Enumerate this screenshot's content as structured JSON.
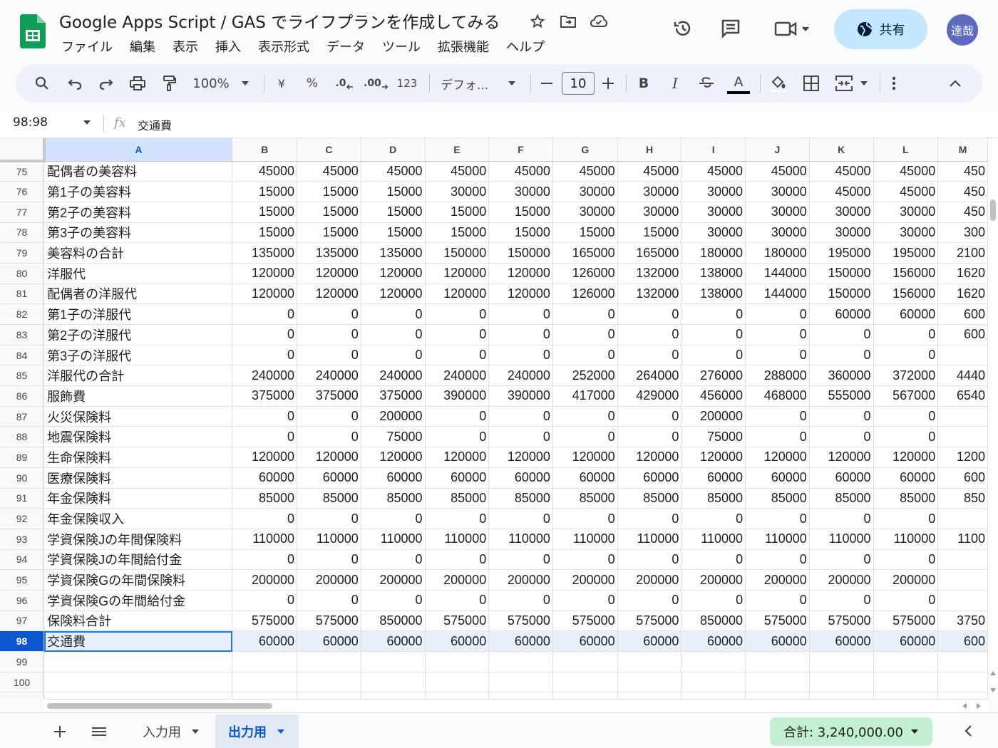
{
  "doc": {
    "title": "Google Apps Script / GAS でライフプランを作成してみる",
    "menu": [
      "ファイル",
      "編集",
      "表示",
      "挿入",
      "表示形式",
      "データ",
      "ツール",
      "拡張機能",
      "ヘルプ"
    ],
    "share_label": "共有",
    "avatar_initials": "達哉"
  },
  "toolbar": {
    "zoom": "100%",
    "currency": "¥",
    "percent": "%",
    "format_123": "123",
    "font": "デフォ...",
    "font_size": "10",
    "decrease_decimal": ".0",
    "increase_decimal": ".00",
    "bold": "B",
    "italic": "I",
    "text_color_glyph": "A"
  },
  "formula_bar": {
    "name_box": "98:98",
    "fx": "fx",
    "formula": "交通費"
  },
  "grid": {
    "columns": [
      "A",
      "B",
      "C",
      "D",
      "E",
      "F",
      "G",
      "H",
      "I",
      "J",
      "K",
      "L",
      "M"
    ],
    "rows": [
      {
        "num": "75",
        "label": "配偶者の美容料",
        "values": [
          "45000",
          "45000",
          "45000",
          "45000",
          "45000",
          "45000",
          "45000",
          "45000",
          "45000",
          "45000",
          "45000",
          "450"
        ]
      },
      {
        "num": "76",
        "label": "第1子の美容料",
        "values": [
          "15000",
          "15000",
          "15000",
          "30000",
          "30000",
          "30000",
          "30000",
          "30000",
          "30000",
          "45000",
          "45000",
          "450"
        ]
      },
      {
        "num": "77",
        "label": "第2子の美容料",
        "values": [
          "15000",
          "15000",
          "15000",
          "15000",
          "15000",
          "30000",
          "30000",
          "30000",
          "30000",
          "30000",
          "30000",
          "450"
        ]
      },
      {
        "num": "78",
        "label": "第3子の美容料",
        "values": [
          "15000",
          "15000",
          "15000",
          "15000",
          "15000",
          "15000",
          "15000",
          "30000",
          "30000",
          "30000",
          "30000",
          "300"
        ]
      },
      {
        "num": "79",
        "label": "美容料の合計",
        "values": [
          "135000",
          "135000",
          "135000",
          "150000",
          "150000",
          "165000",
          "165000",
          "180000",
          "180000",
          "195000",
          "195000",
          "2100"
        ]
      },
      {
        "num": "80",
        "label": "洋服代",
        "values": [
          "120000",
          "120000",
          "120000",
          "120000",
          "120000",
          "126000",
          "132000",
          "138000",
          "144000",
          "150000",
          "156000",
          "1620"
        ]
      },
      {
        "num": "81",
        "label": "配偶者の洋服代",
        "values": [
          "120000",
          "120000",
          "120000",
          "120000",
          "120000",
          "126000",
          "132000",
          "138000",
          "144000",
          "150000",
          "156000",
          "1620"
        ]
      },
      {
        "num": "82",
        "label": "第1子の洋服代",
        "values": [
          "0",
          "0",
          "0",
          "0",
          "0",
          "0",
          "0",
          "0",
          "0",
          "60000",
          "60000",
          "600"
        ]
      },
      {
        "num": "83",
        "label": "第2子の洋服代",
        "values": [
          "0",
          "0",
          "0",
          "0",
          "0",
          "0",
          "0",
          "0",
          "0",
          "0",
          "0",
          "600"
        ]
      },
      {
        "num": "84",
        "label": "第3子の洋服代",
        "values": [
          "0",
          "0",
          "0",
          "0",
          "0",
          "0",
          "0",
          "0",
          "0",
          "0",
          "0",
          ""
        ]
      },
      {
        "num": "85",
        "label": "洋服代の合計",
        "values": [
          "240000",
          "240000",
          "240000",
          "240000",
          "240000",
          "252000",
          "264000",
          "276000",
          "288000",
          "360000",
          "372000",
          "4440"
        ]
      },
      {
        "num": "86",
        "label": "服飾費",
        "values": [
          "375000",
          "375000",
          "375000",
          "390000",
          "390000",
          "417000",
          "429000",
          "456000",
          "468000",
          "555000",
          "567000",
          "6540"
        ]
      },
      {
        "num": "87",
        "label": "火災保険料",
        "values": [
          "0",
          "0",
          "200000",
          "0",
          "0",
          "0",
          "0",
          "200000",
          "0",
          "0",
          "0",
          ""
        ]
      },
      {
        "num": "88",
        "label": "地震保険料",
        "values": [
          "0",
          "0",
          "75000",
          "0",
          "0",
          "0",
          "0",
          "75000",
          "0",
          "0",
          "0",
          ""
        ]
      },
      {
        "num": "89",
        "label": "生命保険料",
        "values": [
          "120000",
          "120000",
          "120000",
          "120000",
          "120000",
          "120000",
          "120000",
          "120000",
          "120000",
          "120000",
          "120000",
          "1200"
        ]
      },
      {
        "num": "90",
        "label": "医療保険料",
        "values": [
          "60000",
          "60000",
          "60000",
          "60000",
          "60000",
          "60000",
          "60000",
          "60000",
          "60000",
          "60000",
          "60000",
          "600"
        ]
      },
      {
        "num": "91",
        "label": "年金保険料",
        "values": [
          "85000",
          "85000",
          "85000",
          "85000",
          "85000",
          "85000",
          "85000",
          "85000",
          "85000",
          "85000",
          "85000",
          "850"
        ]
      },
      {
        "num": "92",
        "label": "年金保険収入",
        "values": [
          "0",
          "0",
          "0",
          "0",
          "0",
          "0",
          "0",
          "0",
          "0",
          "0",
          "0",
          ""
        ]
      },
      {
        "num": "93",
        "label": "学資保険Jの年間保険料",
        "values": [
          "110000",
          "110000",
          "110000",
          "110000",
          "110000",
          "110000",
          "110000",
          "110000",
          "110000",
          "110000",
          "110000",
          "1100"
        ]
      },
      {
        "num": "94",
        "label": "学資保険Jの年間給付金",
        "values": [
          "0",
          "0",
          "0",
          "0",
          "0",
          "0",
          "0",
          "0",
          "0",
          "0",
          "0",
          ""
        ]
      },
      {
        "num": "95",
        "label": "学資保険Gの年間保険料",
        "values": [
          "200000",
          "200000",
          "200000",
          "200000",
          "200000",
          "200000",
          "200000",
          "200000",
          "200000",
          "200000",
          "200000",
          ""
        ]
      },
      {
        "num": "96",
        "label": "学資保険Gの年間給付金",
        "values": [
          "0",
          "0",
          "0",
          "0",
          "0",
          "0",
          "0",
          "0",
          "0",
          "0",
          "0",
          ""
        ]
      },
      {
        "num": "97",
        "label": "保険料合計",
        "values": [
          "575000",
          "575000",
          "850000",
          "575000",
          "575000",
          "575000",
          "575000",
          "850000",
          "575000",
          "575000",
          "575000",
          "3750"
        ]
      },
      {
        "num": "98",
        "label": "交通費",
        "values": [
          "60000",
          "60000",
          "60000",
          "60000",
          "60000",
          "60000",
          "60000",
          "60000",
          "60000",
          "60000",
          "60000",
          "600"
        ],
        "selected": true
      },
      {
        "num": "99",
        "label": "",
        "values": [
          "",
          "",
          "",
          "",
          "",
          "",
          "",
          "",
          "",
          "",
          "",
          ""
        ]
      },
      {
        "num": "100",
        "label": "",
        "values": [
          "",
          "",
          "",
          "",
          "",
          "",
          "",
          "",
          "",
          "",
          "",
          ""
        ]
      },
      {
        "num": "101",
        "label": "",
        "values": [
          "",
          "",
          "",
          "",
          "",
          "",
          "",
          "",
          "",
          "",
          "",
          ""
        ]
      }
    ]
  },
  "sheets": {
    "tabs": [
      {
        "label": "入力用",
        "active": false
      },
      {
        "label": "出力用",
        "active": true
      }
    ],
    "sum_label": "合計: 3,240,000.00"
  },
  "colors": {
    "accent": "#0b57d0",
    "share_bg": "#c2e7ff",
    "sum_bg": "#c4eed0",
    "sheets_green": "#0f9d58",
    "avatar_bg": "#5c6bc0"
  }
}
